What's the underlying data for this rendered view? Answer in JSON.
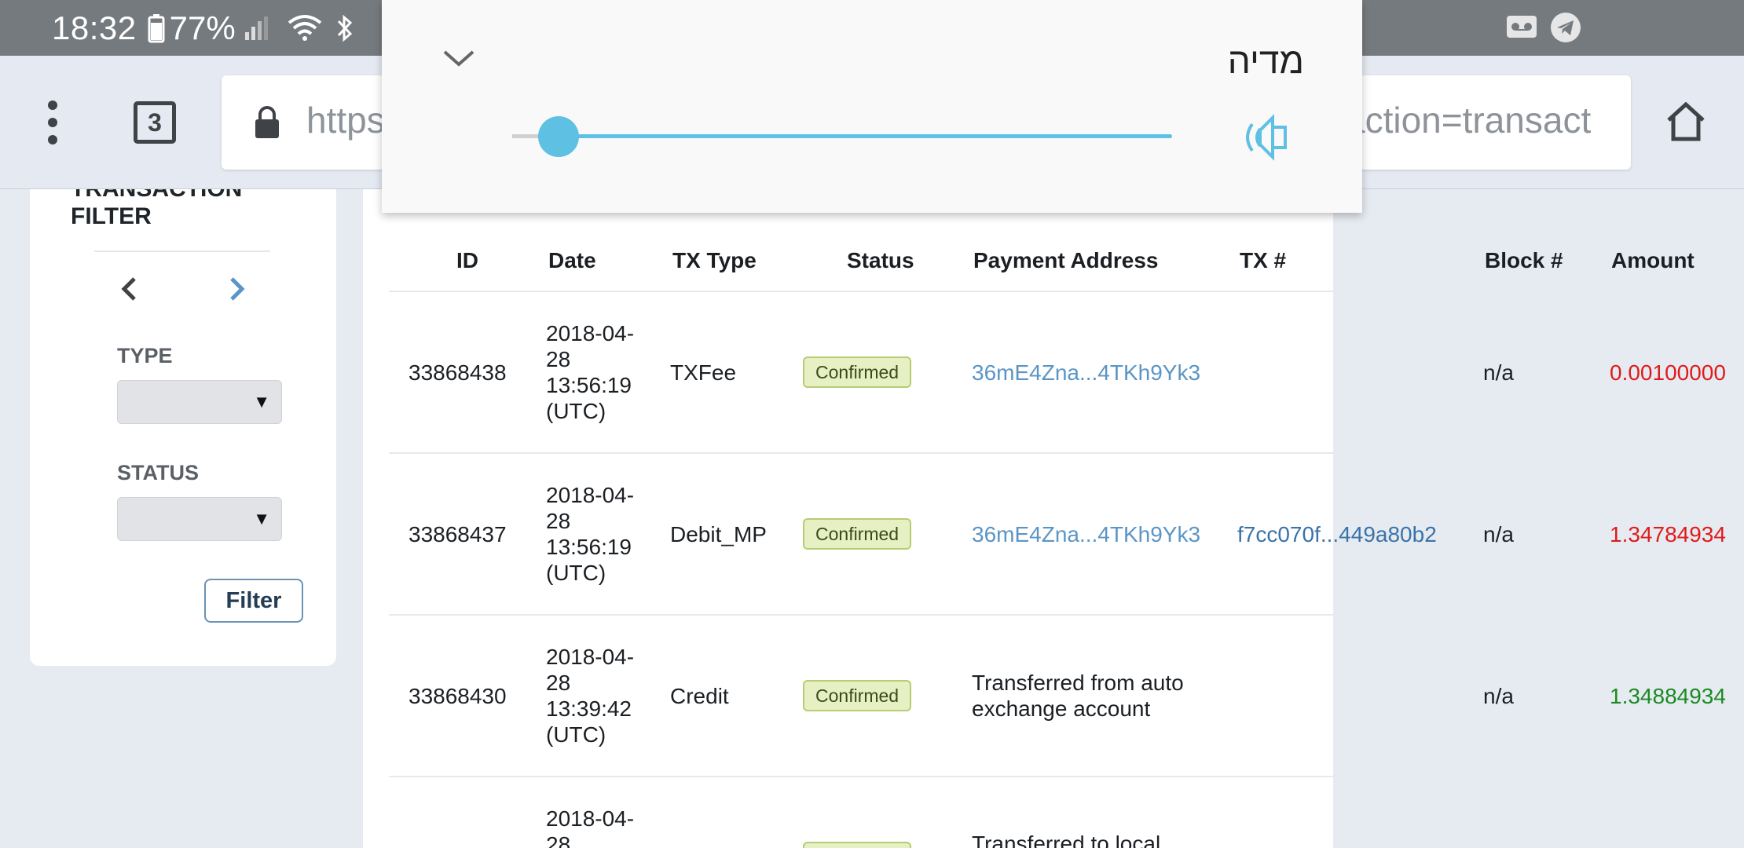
{
  "status_bar": {
    "time": "18:32",
    "battery": "77%"
  },
  "browser": {
    "tab_count": "3",
    "url_start": "https",
    "url_end": "action=transact"
  },
  "filter": {
    "title": "TRANSACTION FILTER",
    "type_label": "TYPE",
    "status_label": "STATUS",
    "button_label": "Filter"
  },
  "table": {
    "headers": [
      "ID",
      "Date",
      "TX Type",
      "Status",
      "Payment Address",
      "TX #",
      "Block #",
      "Amount"
    ],
    "rows": [
      {
        "id": "33868438",
        "date": "2018-04-28 13:56:19 (UTC)",
        "type": "TXFee",
        "status": "Confirmed",
        "address": "36mE4Zna...4TKh9Yk3",
        "tx": "",
        "block": "n/a",
        "amount": "0.00100000"
      },
      {
        "id": "33868437",
        "date": "2018-04-28 13:56:19 (UTC)",
        "type": "Debit_MP",
        "status": "Confirmed",
        "address": "36mE4Zna...4TKh9Yk3",
        "tx": "f7cc070f...449a80b2",
        "block": "n/a",
        "amount": "1.34784934"
      },
      {
        "id": "33868430",
        "date": "2018-04-28 13:39:42 (UTC)",
        "type": "Credit",
        "status": "Confirmed",
        "address": "Transferred from auto exchange account",
        "tx": "",
        "block": "n/a",
        "amount": "1.34884934"
      },
      {
        "date": "2018-04-28",
        "status": "Confirmed",
        "address": "Transferred to local"
      }
    ]
  },
  "volume_popup": {
    "label": "מדיה",
    "level": 0.07
  },
  "colors": {
    "accent": "#5ec0e2",
    "link": "#5b95c5",
    "negative": "#e01b1b",
    "positive": "#1c8a23"
  }
}
